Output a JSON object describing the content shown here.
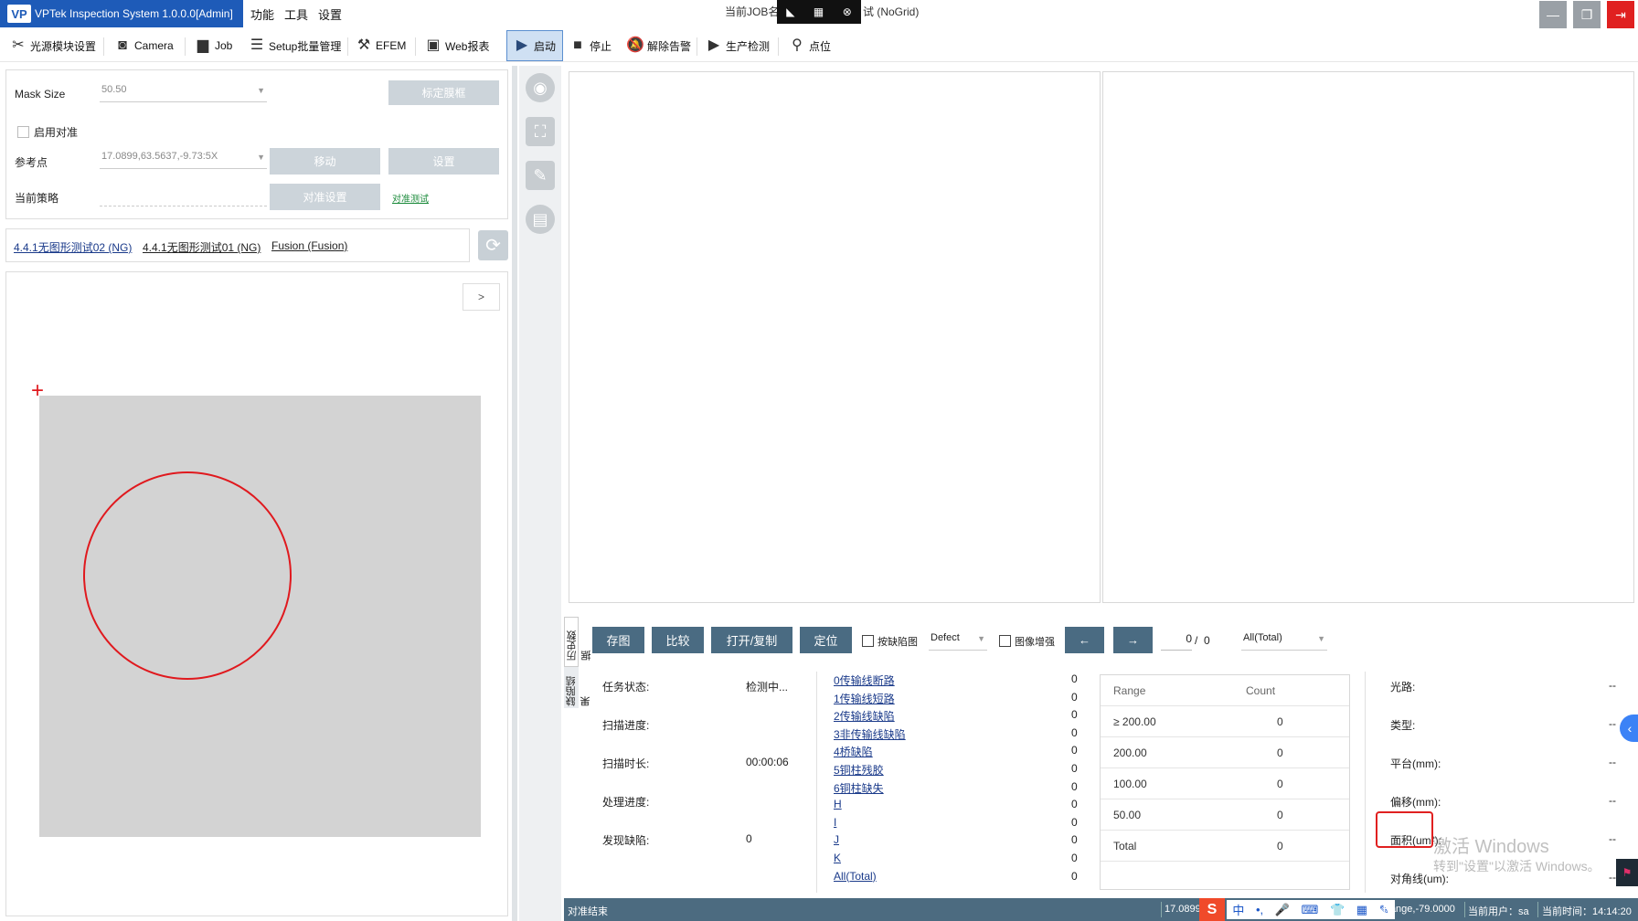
{
  "titlebar": {
    "app_title": "VPTek Inspection System 1.0.0.0[Admin]",
    "logo_text": "VP",
    "menu": [
      "功能",
      "工具",
      "设置"
    ],
    "job_prefix": "当前JOB名",
    "job_suffix": "试 (NoGrid)",
    "window_buttons": [
      "minimize-icon",
      "restore-icon",
      "close-icon"
    ]
  },
  "toolbar": {
    "items": [
      {
        "label": "光源模块设置",
        "icon": "light-tools-icon"
      },
      {
        "label": "Camera",
        "icon": "camera-icon"
      },
      {
        "label": "Job",
        "icon": "briefcase-icon"
      },
      {
        "label": "Setup批量管理",
        "icon": "list-icon"
      },
      {
        "label": "EFEM",
        "icon": "robot-arm-icon"
      },
      {
        "label": "Web报表",
        "icon": "web-report-icon"
      },
      {
        "label": "启动",
        "icon": "play-icon",
        "active": true
      },
      {
        "label": "停止",
        "icon": "stop-icon"
      },
      {
        "label": "解除告警",
        "icon": "bell-off-icon"
      },
      {
        "label": "生产检测",
        "icon": "play-icon"
      },
      {
        "label": "点位",
        "icon": "location-icon"
      }
    ]
  },
  "left_panel": {
    "mask_size_label": "Mask Size",
    "mask_size_value": "50.50",
    "calibrate_button": "标定膜框",
    "enable_align_label": "启用对准",
    "ref_point_label": "参考点",
    "ref_point_value": "17.0899,63.5637,-9.73:5X",
    "move_button": "移动",
    "set_button": "设置",
    "strategy_label": "当前策略",
    "align_settings_button": "对准设置",
    "align_test_link": "对准测试"
  },
  "recipe_links": [
    "4.4.1无图形测试02 (NG)",
    "4.4.1无图形测试01 (NG)",
    "Fusion (Fusion)"
  ],
  "preview": {
    "expand_button": ">",
    "crosshair": "+",
    "colors": {
      "wafer": "#d3d3d3",
      "circle": "#e0191e"
    }
  },
  "side_tabs": [
    "缺陷结果",
    "历史数据"
  ],
  "result_toolbar": {
    "buttons": [
      "存图",
      "比较",
      "打开/复制",
      "定位"
    ],
    "by_defect_label": "按缺陷图",
    "defect_select": "Defect",
    "enhance_label": "图像增强",
    "prev": "←",
    "next": "→",
    "page_current": "0",
    "page_sep": "/",
    "page_total": "0",
    "filter_select": "All(Total)"
  },
  "task_info": [
    {
      "label": "任务状态:",
      "value": "检测中..."
    },
    {
      "label": "扫描进度:",
      "value": ""
    },
    {
      "label": "扫描时长:",
      "value": "00:00:06"
    },
    {
      "label": "处理进度:",
      "value": ""
    },
    {
      "label": "发现缺陷:",
      "value": "0"
    }
  ],
  "defect_types": [
    {
      "name": "0传输线断路",
      "count": "0"
    },
    {
      "name": "1传输线短路",
      "count": "0"
    },
    {
      "name": "2传输线缺陷",
      "count": "0"
    },
    {
      "name": "3非传输线缺陷",
      "count": "0"
    },
    {
      "name": "4桥缺陷",
      "count": "0"
    },
    {
      "name": "5铜柱残胶",
      "count": "0"
    },
    {
      "name": "6铜柱缺失",
      "count": "0"
    },
    {
      "name": "H",
      "count": "0"
    },
    {
      "name": "I",
      "count": "0"
    },
    {
      "name": "J",
      "count": "0"
    },
    {
      "name": "K",
      "count": "0"
    },
    {
      "name": "All(Total)",
      "count": "0"
    }
  ],
  "range_table": {
    "headers": [
      "Range",
      "Count"
    ],
    "rows": [
      {
        "range": "≥ 200.00",
        "count": "0"
      },
      {
        "range": "200.00",
        "count": "0"
      },
      {
        "range": "100.00",
        "count": "0"
      },
      {
        "range": "50.00",
        "count": "0"
      },
      {
        "range": "Total",
        "count": "0"
      }
    ]
  },
  "detail_info": [
    {
      "label": "光路:",
      "value": "--"
    },
    {
      "label": "类型:",
      "value": "--"
    },
    {
      "label": "平台(mm):",
      "value": "--"
    },
    {
      "label": "偏移(mm):",
      "value": "--"
    },
    {
      "label": "面积(um²):",
      "value": "--"
    },
    {
      "label": "对角线(um):",
      "value": "--"
    }
  ],
  "watermark": {
    "line1": "激活 Windows",
    "line2": "转到\"设置\"以激活 Windows。"
  },
  "status_bar": {
    "left": "对准结束",
    "coord": "17.0899",
    "ime": "中",
    "range": "Range,-79.0000",
    "user": "当前用户：sa",
    "time": "当前时间：14:14:20"
  }
}
